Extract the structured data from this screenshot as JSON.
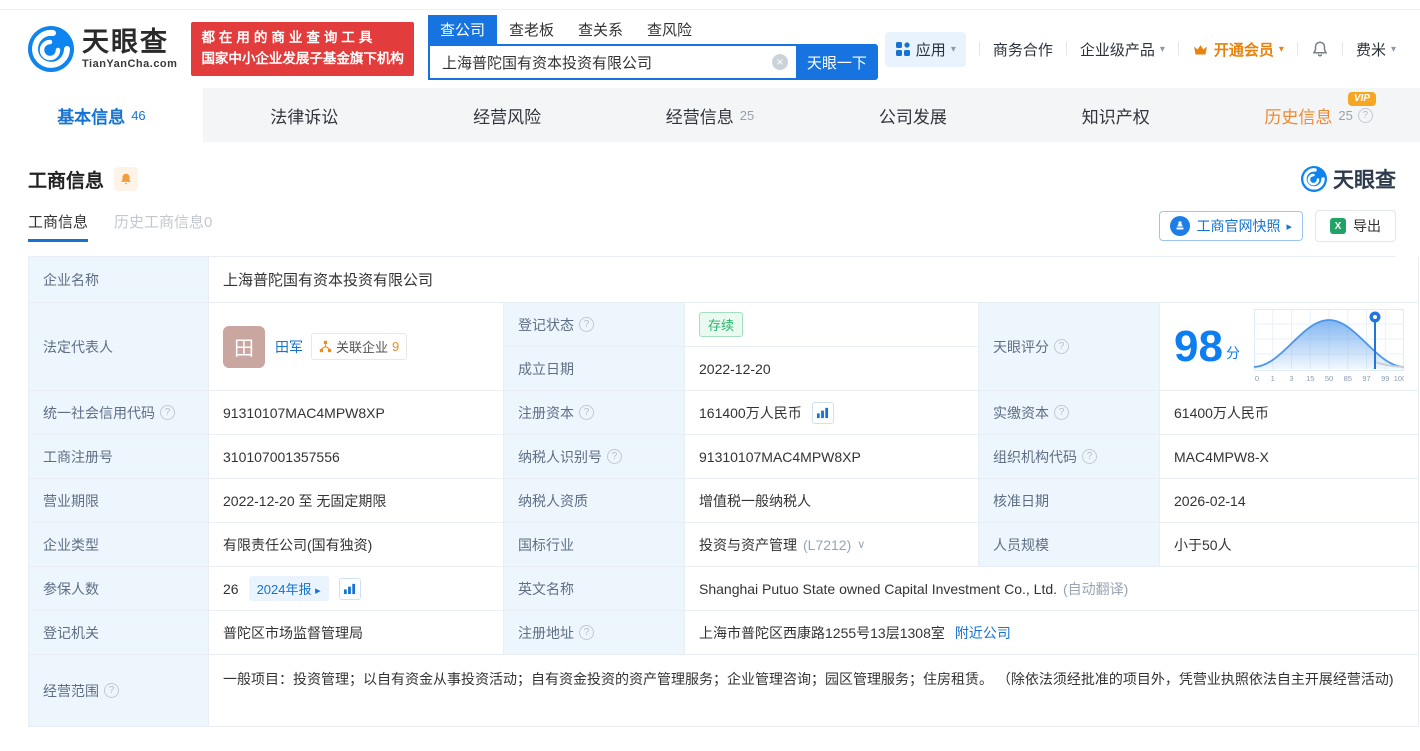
{
  "brand": {
    "logo_text": "天眼查",
    "logo_domain": "TianYanCha.com",
    "slogan_line1": "都在用的商业查询工具",
    "slogan_line2": "国家中小企业发展子基金旗下机构"
  },
  "icons": {
    "clear": "×",
    "chevron_down": "▾",
    "chevron_down_thin": "∨",
    "arrow_right": "▸",
    "help": "?",
    "excel_glyph": "X"
  },
  "search": {
    "tabs": [
      "查公司",
      "查老板",
      "查关系",
      "查风险"
    ],
    "value": "上海普陀国有资本投资有限公司",
    "button_label": "天眼一下"
  },
  "header_menu": {
    "apps": "应用",
    "cooperation": "商务合作",
    "enterprise_products": "企业级产品",
    "vip": "开通会员",
    "username": "费米"
  },
  "nav_tabs": [
    {
      "label": "基本信息",
      "count": "46"
    },
    {
      "label": "法律诉讼"
    },
    {
      "label": "经营风险"
    },
    {
      "label": "经营信息",
      "count": "25"
    },
    {
      "label": "公司发展"
    },
    {
      "label": "知识产权"
    },
    {
      "label": "历史信息",
      "count": "25",
      "vip_badge": "VIP"
    }
  ],
  "section": {
    "title": "工商信息",
    "subtab_active": "工商信息",
    "subtab_history": "历史工商信息0",
    "snapshot_button": "工商官网快照",
    "export_button": "导出",
    "watermark": "天眼查"
  },
  "table": {
    "company_name_label": "企业名称",
    "company_name": "上海普陀国有资本投资有限公司",
    "legal_rep_label": "法定代表人",
    "legal_rep_avatar": "田",
    "legal_rep_name": "田军",
    "related_label": "关联企业",
    "related_count": "9",
    "reg_status_label": "登记状态",
    "reg_status": "存续",
    "establish_label": "成立日期",
    "establish_date": "2022-12-20",
    "score_label": "天眼评分",
    "score": "98",
    "score_unit": "分",
    "credit_code_label": "统一社会信用代码",
    "credit_code": "91310107MAC4MPW8XP",
    "reg_capital_label": "注册资本",
    "reg_capital": "161400万人民币",
    "paid_capital_label": "实缴资本",
    "paid_capital": "61400万人民币",
    "reg_number_label": "工商注册号",
    "reg_number": "310107001357556",
    "taxpayer_id_label": "纳税人识别号",
    "taxpayer_id": "91310107MAC4MPW8XP",
    "org_code_label": "组织机构代码",
    "org_code": "MAC4MPW8-X",
    "business_term_label": "营业期限",
    "business_term": "2022-12-20 至 无固定期限",
    "taxpayer_quality_label": "纳税人资质",
    "taxpayer_quality": "增值税一般纳税人",
    "approval_date_label": "核准日期",
    "approval_date": "2026-02-14",
    "company_type_label": "企业类型",
    "company_type": "有限责任公司(国有独资)",
    "industry_label": "国标行业",
    "industry": "投资与资产管理",
    "industry_code": "(L7212)",
    "staff_size_label": "人员规模",
    "staff_size": "小于50人",
    "insured_label": "参保人数",
    "insured_count": "26",
    "annual_report_badge": "2024年报",
    "english_name_label": "英文名称",
    "english_name": "Shanghai Putuo State owned Capital Investment Co., Ltd.",
    "auto_translate_note": "(自动翻译)",
    "reg_authority_label": "登记机关",
    "reg_authority": "普陀区市场监督管理局",
    "address_label": "注册地址",
    "address": "上海市普陀区西康路1255号13层1308室",
    "nearby_link": "附近公司",
    "business_scope_label": "经营范围",
    "business_scope": "一般项目：投资管理；以自有资金从事投资活动；自有资金投资的资产管理服务；企业管理咨询；园区管理服务；住房租赁。 （除依法须经批准的项目外，凭营业执照依法自主开展经营活动)"
  },
  "score_chart": {
    "type": "area",
    "score": 98,
    "marker_value": 98,
    "ticks": [
      "0",
      "1",
      "3",
      "15",
      "50",
      "85",
      "97",
      "99",
      "100"
    ],
    "shape": "normal-distribution-curve",
    "peak_at_tick": "50"
  }
}
